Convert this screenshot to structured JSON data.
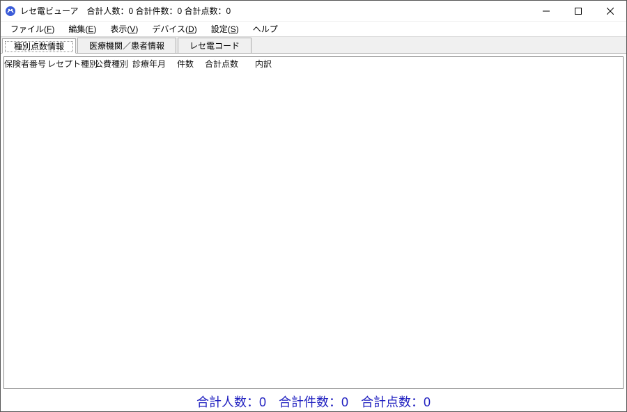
{
  "window": {
    "title": "レセ電ビューア　合計人数：0 合計件数：0 合計点数：0"
  },
  "menu": {
    "file": {
      "label_pre": "ファイル(",
      "mn": "F",
      "label_post": ")"
    },
    "edit": {
      "label_pre": "編集(",
      "mn": "E",
      "label_post": ")"
    },
    "view": {
      "label_pre": "表示(",
      "mn": "V",
      "label_post": ")"
    },
    "device": {
      "label_pre": "デバイス(",
      "mn": "D",
      "label_post": ")"
    },
    "setting": {
      "label_pre": "設定(",
      "mn": "S",
      "label_post": ")"
    },
    "help": {
      "label": "ヘルプ"
    }
  },
  "tabs": {
    "t0": "種別点数情報",
    "t1": "医療機関／患者情報",
    "t2": "レセ電コード"
  },
  "columns": {
    "c0": "保険者番号",
    "c1": "レセプト種別",
    "c2": "公費種別",
    "c3": "診療年月",
    "c4": "件数",
    "c5": "合計点数",
    "c6": "内訳"
  },
  "status": {
    "people": "合計人数：0",
    "count": "合計件数：0",
    "points": "合計点数：0"
  }
}
